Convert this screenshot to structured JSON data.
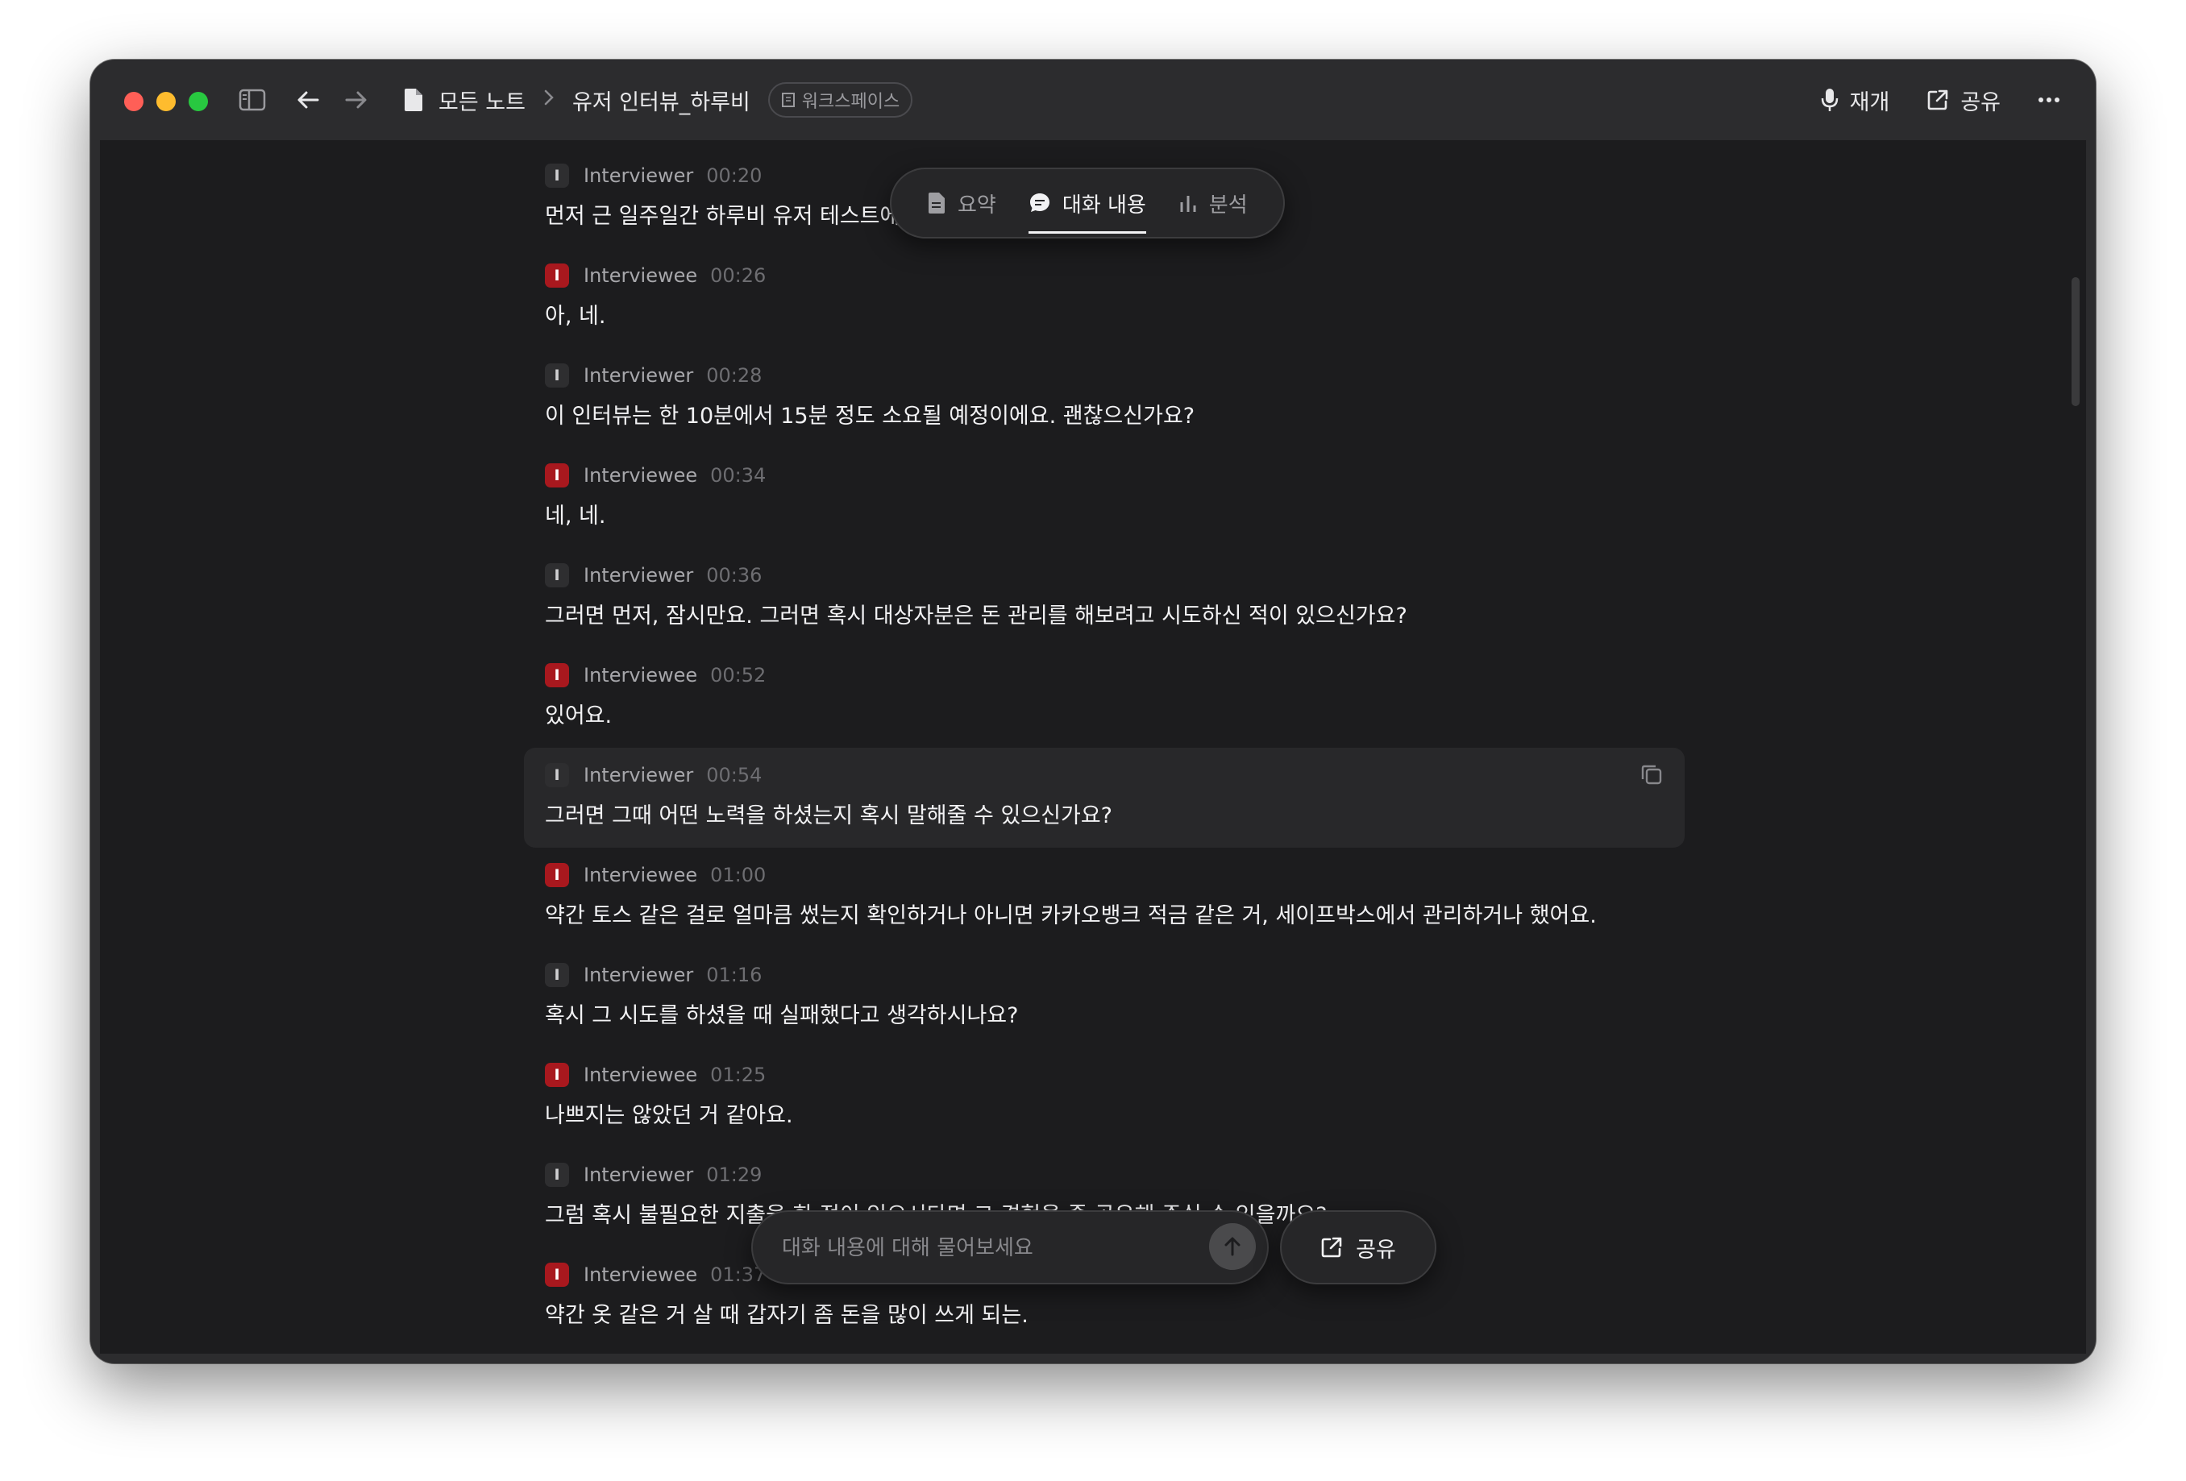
{
  "breadcrumb": {
    "root": "모든 노트",
    "note_title": "유저 인터뷰_하루비",
    "workspace_badge": "워크스페이스"
  },
  "toolbar": {
    "resume_label": "재개",
    "share_label": "공유",
    "more_icon": "ellipsis-icon"
  },
  "tabs": [
    {
      "label": "요약",
      "icon": "document-icon",
      "active": false
    },
    {
      "label": "대화 내용",
      "icon": "chat-bubble-icon",
      "active": true
    },
    {
      "label": "분석",
      "icon": "bar-chart-icon",
      "active": false
    }
  ],
  "transcript": [
    {
      "avatar": "I",
      "speaker": "Interviewer",
      "time": "00:20",
      "text": "먼저 근 일주일간 하루비 유저 테스트에 참"
    },
    {
      "avatar": "I",
      "speaker": "Interviewee",
      "time": "00:26",
      "text": "아, 네."
    },
    {
      "avatar": "I",
      "speaker": "Interviewer",
      "time": "00:28",
      "text": "이 인터뷰는 한 10분에서 15분 정도 소요될 예정이에요. 괜찮으신가요?"
    },
    {
      "avatar": "I",
      "speaker": "Interviewee",
      "time": "00:34",
      "text": "네, 네."
    },
    {
      "avatar": "I",
      "speaker": "Interviewer",
      "time": "00:36",
      "text": "그러면 먼저, 잠시만요. 그러면 혹시 대상자분은 돈 관리를 해보려고 시도하신 적이 있으신가요?"
    },
    {
      "avatar": "I",
      "speaker": "Interviewee",
      "time": "00:52",
      "text": "있어요."
    },
    {
      "avatar": "I",
      "speaker": "Interviewer",
      "time": "00:54",
      "text": "그러면 그때 어떤 노력을 하셨는지 혹시 말해줄 수 있으신가요?"
    },
    {
      "avatar": "I",
      "speaker": "Interviewee",
      "time": "01:00",
      "text": "약간 토스 같은 걸로 얼마큼 썼는지 확인하거나 아니면 카카오뱅크 적금 같은 거, 세이프박스에서 관리하거나 했어요."
    },
    {
      "avatar": "I",
      "speaker": "Interviewer",
      "time": "01:16",
      "text": "혹시 그 시도를 하셨을 때 실패했다고 생각하시나요?"
    },
    {
      "avatar": "I",
      "speaker": "Interviewee",
      "time": "01:25",
      "text": "나쁘지는 않았던 거 같아요."
    },
    {
      "avatar": "I",
      "speaker": "Interviewer",
      "time": "01:29",
      "text": "그럼 혹시 불필요한 지출을 한 적이 있으시다면 그 경험을 좀 공유해 주실 수 있을까요?"
    },
    {
      "avatar": "I",
      "speaker": "Interviewee",
      "time": "01:37",
      "text": "약간 옷 같은 거 살 때 갑자기 좀 돈을 많이 쓰게 되는."
    }
  ],
  "ask": {
    "placeholder": "대화 내용에 대해 물어보세요",
    "share_label": "공유"
  },
  "colors": {
    "interviewee_avatar": "#a8181e",
    "interviewer_avatar": "#2e2e30",
    "background": "#1c1c1e"
  }
}
